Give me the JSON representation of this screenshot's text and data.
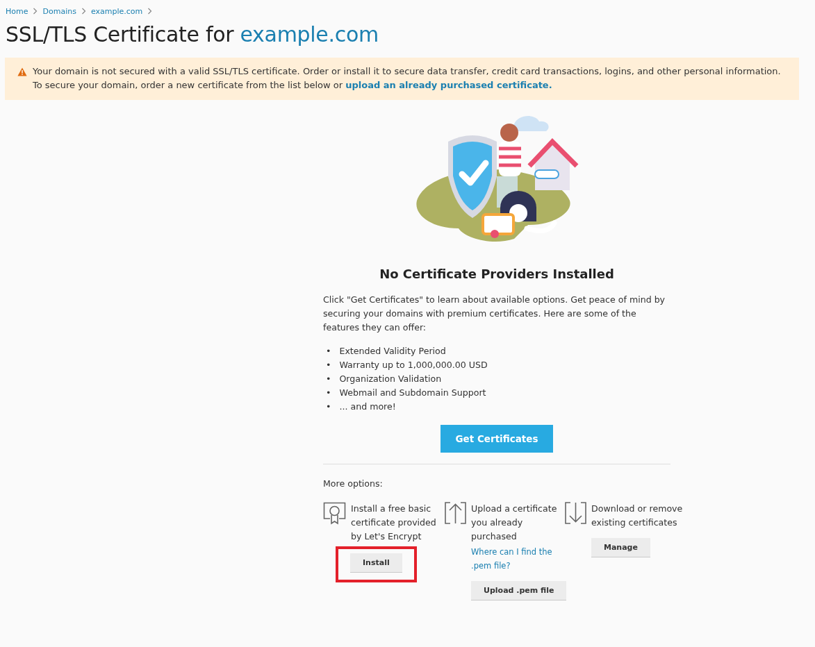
{
  "breadcrumbs": [
    "Home",
    "Domains",
    "example.com"
  ],
  "title": {
    "prefix": "SSL/TLS Certificate for",
    "domain": "example.com"
  },
  "alert": {
    "line_1": "Your domain is not secured with a valid SSL/TLS certificate. Order or install it to secure data transfer, credit card transactions, logins, and other personal information.",
    "line_2": "To secure your domain, order a new certificate from the list below or",
    "link": "upload an already purchased certificate."
  },
  "empty_state": {
    "heading": "No Certificate Providers Installed",
    "description": "Click \"Get Certificates\" to learn about available options. Get peace of mind by securing your domains with premium certificates. Here are some of the features they can offer:",
    "bullet": "•",
    "features": [
      "Extended Validity Period",
      "Warranty up to 1,000,000.00 USD",
      "Organization Validation",
      "Webmail and Subdomain Support",
      "... and more!"
    ],
    "button": "Get Certificates"
  },
  "more_options": {
    "label": "More options:",
    "options": [
      {
        "kind": "certificate",
        "text": "Install a free basic certificate provided by Let's Encrypt",
        "button": "Install",
        "highlighted": true
      },
      {
        "kind": "upload",
        "text": "Upload a certificate you already purchased",
        "link": "Where can I find the .pem file?",
        "button": "Upload .pem file",
        "highlighted": false
      },
      {
        "kind": "download",
        "text": "Download or remove existing certificates",
        "button": "Manage",
        "highlighted": false
      }
    ]
  }
}
